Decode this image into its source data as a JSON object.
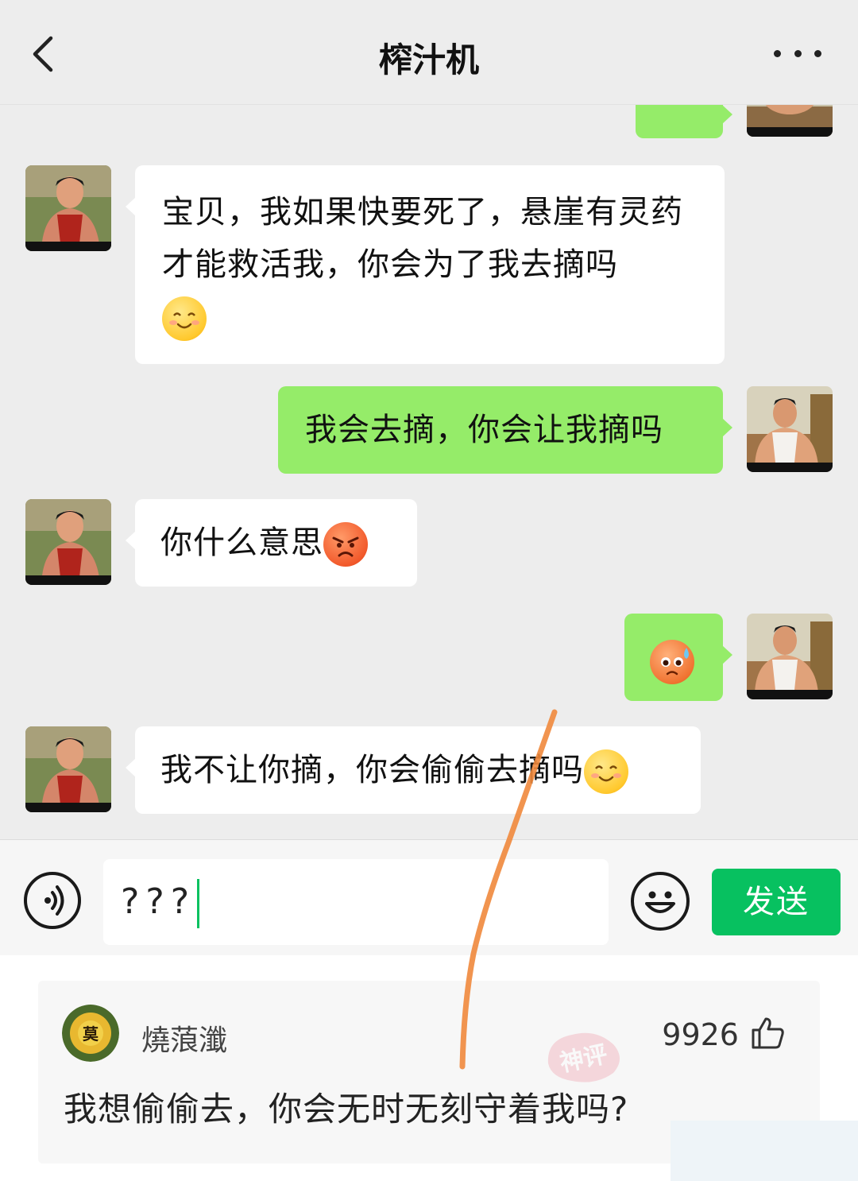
{
  "header": {
    "title": "榨汁机"
  },
  "messages": [
    {
      "side": "left",
      "text": "宝贝，我如果快要死了，悬崖有灵药才能救活我，你会为了我去摘吗",
      "emoji": "smile-emoji"
    },
    {
      "side": "right",
      "text": "我会去摘，你会让我摘吗"
    },
    {
      "side": "left",
      "text": "你什么意思",
      "emoji": "angry-emoji"
    },
    {
      "side": "right",
      "text": "",
      "emoji": "sweat-emoji"
    },
    {
      "side": "left",
      "text": "我不让你摘，你会偷偷去摘吗",
      "emoji": "smile-emoji"
    }
  ],
  "input": {
    "value": "???",
    "send_label": "发送"
  },
  "comment": {
    "avatar_text": "莫",
    "username": "燒蒗瀸",
    "likes": "9926",
    "text": "我想偷偷去，你会无时无刻守着我吗?"
  },
  "watermark": {
    "text": "神评"
  },
  "colors": {
    "chat_bg": "#ededed",
    "bubble_right": "#95ec69",
    "bubble_left": "#ffffff",
    "send_button": "#07c160",
    "annotation_line": "#f0883c"
  }
}
